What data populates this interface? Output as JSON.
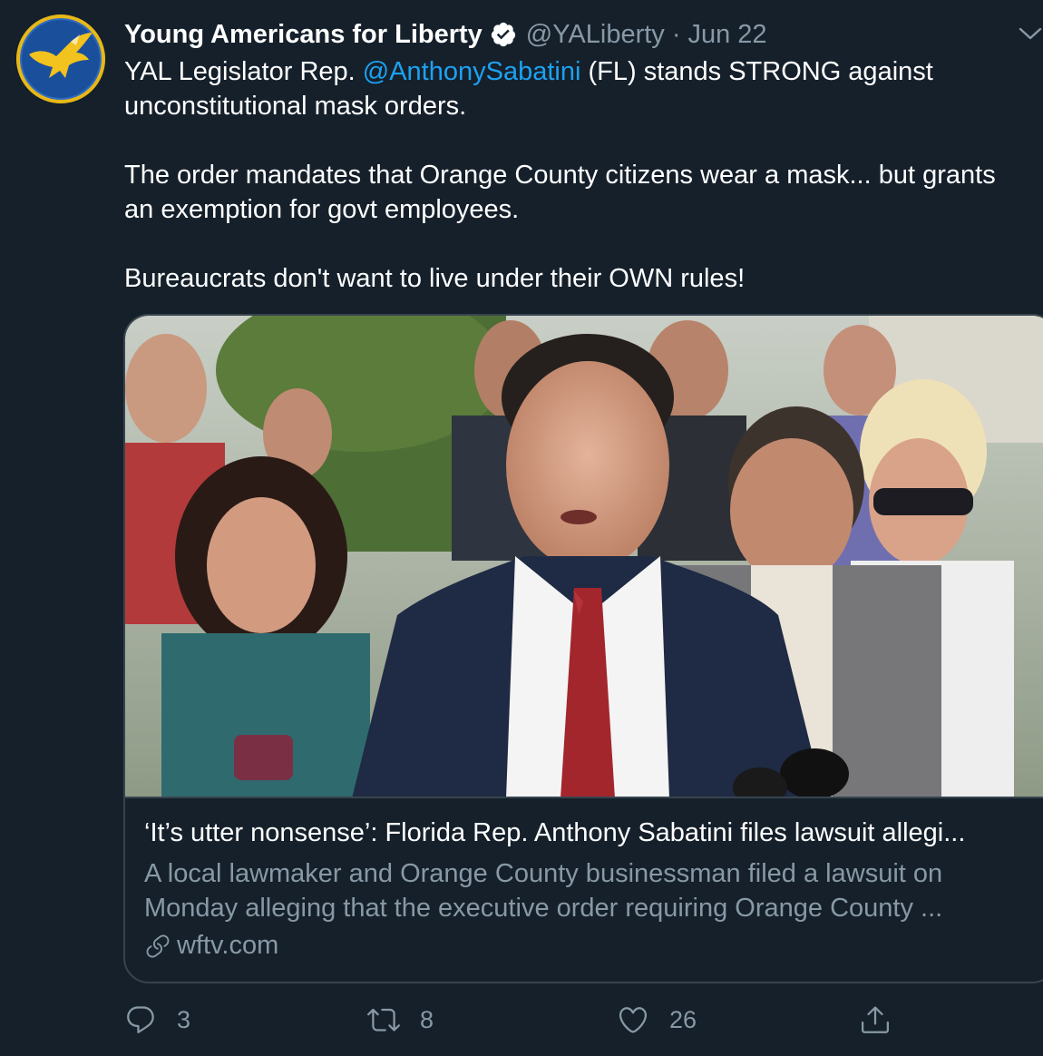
{
  "tweet": {
    "author": {
      "display_name": "Young Americans for Liberty",
      "handle": "@YALiberty",
      "verified": true
    },
    "separator": "·",
    "date": "Jun 22",
    "text": {
      "p1_before": "YAL Legislator Rep. ",
      "p1_mention": "@AnthonySabatini",
      "p1_after": " (FL) stands STRONG against unconstitutional mask orders.",
      "p2": "The order mandates that Orange County citizens wear a mask... but grants an exemption for govt employees.",
      "p3": "Bureaucrats don't want to live under their OWN rules!"
    },
    "card": {
      "title": "‘It’s utter nonsense’: Florida Rep. Anthony Sabatini files lawsuit allegi...",
      "description": "A local lawmaker and Orange County businessman filed a lawsuit on Monday alleging that the executive order requiring Orange County ...",
      "domain": "wftv.com"
    },
    "actions": {
      "replies": "3",
      "retweets": "8",
      "likes": "26"
    }
  },
  "icons": {
    "avatar": "eagle-logo",
    "verified": "verified-badge-icon",
    "caret": "chevron-down-icon",
    "reply": "reply-icon",
    "retweet": "retweet-icon",
    "like": "heart-icon",
    "share": "share-icon",
    "link": "link-icon"
  },
  "colors": {
    "background": "#15202b",
    "text": "#ffffff",
    "secondary": "#8899a6",
    "accent": "#1da1f2",
    "border": "#38444d"
  }
}
